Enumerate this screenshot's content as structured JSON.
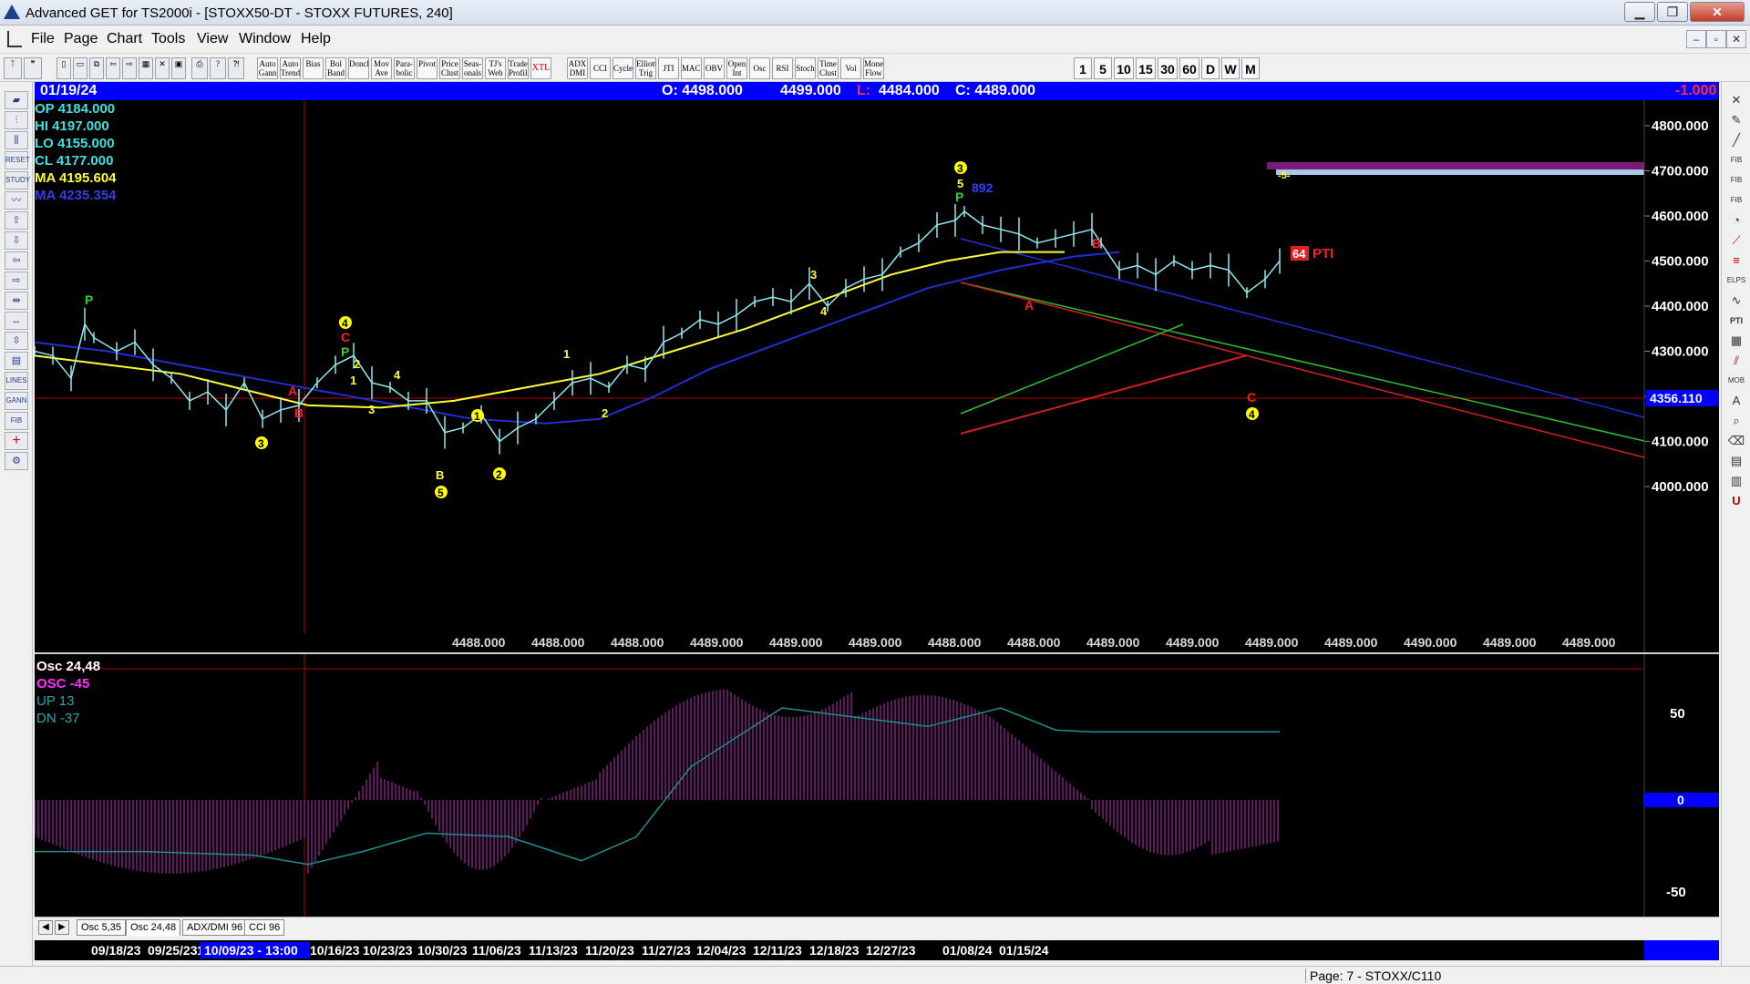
{
  "window": {
    "title": "Advanced GET for TS2000i - [STOXX50-DT - STOXX FUTURES, 240]",
    "minimize": "▁",
    "maximize": "❐",
    "close": "✕"
  },
  "menu": {
    "items": [
      "File",
      "Page",
      "Chart",
      "Tools",
      "View",
      "Window",
      "Help"
    ],
    "mdi_minimize": "‒",
    "mdi_restore": "▫",
    "mdi_close": "✕"
  },
  "toolbar": {
    "buttons": [
      "Auto Gann",
      "Auto Trend",
      "Bias",
      "Bol Band",
      "Donch",
      "Mov Ave",
      "Para- bolic",
      "Pivot",
      "Price Clust",
      "Seas- onals",
      "TJ's Web",
      "Trade Profile",
      "XTL",
      "ADX DMI",
      "CCI",
      "Cycles",
      "Elliott Trig",
      "JTI",
      "MACD",
      "OBV",
      "Open Int",
      "Osc",
      "RSI",
      "Stoch",
      "Time Clust",
      "Vol",
      "Money Flow"
    ],
    "periods": [
      "1",
      "5",
      "10",
      "15",
      "30",
      "60",
      "D",
      "W",
      "M"
    ]
  },
  "header": {
    "date": "01/19/24",
    "open": "O: 4498.000",
    "high": "4499.000",
    "low_label": "L:",
    "low": "4484.000",
    "close": "C: 4489.000",
    "change": "-1.000"
  },
  "price_panel": {
    "info": {
      "op": "OP 4184.000",
      "hi": "HI  4197.000",
      "lo": "LO  4155.000",
      "cl": "CL  4177.000",
      "ma1": "MA 4195.604",
      "ma2": "MA 4235.354"
    },
    "y_labels": [
      "4800.000",
      "4700.000",
      "4600.000",
      "4500.000",
      "4400.000",
      "4300.000",
      "4200.000",
      "4100.000",
      "4000.000"
    ],
    "current_price": "4356.110",
    "bottom_values": [
      "4488.000",
      "4488.000",
      "4488.000",
      "4489.000",
      "4489.000",
      "4489.000",
      "4488.000",
      "4488.000",
      "4489.000",
      "4489.000",
      "4489.000",
      "4489.000",
      "4490.000",
      "4489.000",
      "4489.000"
    ],
    "annotations": {
      "p1": "P",
      "a1": "A",
      "b1": "B",
      "three1": "3",
      "four_top": "4",
      "c_top": "C",
      "p_top": "P",
      "two_top": "2",
      "one_a": "1",
      "four_b": "4",
      "three_b": "3",
      "b_low": "B",
      "five_low": "5",
      "one_mid": "1",
      "two_low": "2",
      "one_up": "1",
      "two_up": "2",
      "three_up": "3",
      "four_up": "4",
      "three_peak": "3",
      "five_peak": "5",
      "p_peak": "P",
      "num_892": "892",
      "b_right": "B",
      "a_right": "A",
      "c_right": "C",
      "four_right": "4",
      "pti_num": "64",
      "pti": "PTI",
      "five_proj": "-5-"
    },
    "colors": {
      "yellow_ma": "#ffff33",
      "blue_ma": "#1f2fd0",
      "bars": "#8fe9ef",
      "ref_line": "#b00000"
    }
  },
  "osc_panel": {
    "title": "Osc 24,48",
    "osc": "OSC -45",
    "up": "UP   13",
    "dn": "DN   -37",
    "y_labels": [
      "50",
      "0",
      "-50"
    ]
  },
  "tabs": [
    "Osc 5,35",
    "Osc 24,48",
    "ADX/DMI 96",
    "CCI 96"
  ],
  "date_axis": {
    "labels": [
      "09/18/23",
      "09/25/23",
      "1",
      "10/09/23 - 13:00",
      "10/16/23",
      "10/23/23",
      "10/30/23",
      "11/06/23",
      "11/13/23",
      "11/20/23",
      "11/27/23",
      "12/04/23",
      "12/11/23",
      "12/18/23",
      "12/27/23",
      "01/08/24",
      "01/15/24"
    ]
  },
  "status": {
    "text": "Page: 7 - STOXX/C110"
  }
}
